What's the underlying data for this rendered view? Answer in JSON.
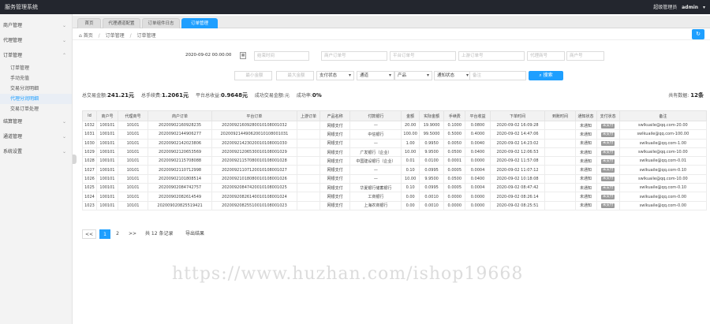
{
  "topbar": {
    "title": "服务管理系统",
    "role": "超级管理员",
    "username": "admin"
  },
  "sidebar": {
    "groups": [
      {
        "label": "商户管理"
      },
      {
        "label": "代理管理"
      },
      {
        "label": "订单管理",
        "children": [
          "订单管理",
          "手动充值",
          "交易分润明细",
          "代理分润明细",
          "交易订单处理"
        ]
      },
      {
        "label": "结算管理"
      },
      {
        "label": "通道管理"
      },
      {
        "label": "系统设置"
      }
    ]
  },
  "tabs": [
    "首页",
    "代理通道配置",
    "订单组件日志",
    "订单管理"
  ],
  "breadcrumb": [
    "首页",
    "订单管理",
    "订单管理"
  ],
  "filters": {
    "date_value": "2020-09-02 00:00:00",
    "date_end_placeholder": "结束时间",
    "merchant_order_placeholder": "商户订单号",
    "platform_order_placeholder": "平台订单号",
    "upstream_order_placeholder": "上游订单号",
    "agent_id_placeholder": "代理商号",
    "merchant_id_placeholder": "商户号",
    "min_amount_placeholder": "最小金额",
    "max_amount_placeholder": "最大金额",
    "pay_status": "支付状态",
    "channel": "通道",
    "product": "产品",
    "notify_status": "通知状态",
    "remark_placeholder": "备注",
    "search_label": "搜索"
  },
  "stats": {
    "total_amount_label": "总交易金额:",
    "total_amount": "241.21元",
    "total_fee_label": "总手续费:",
    "total_fee": "1.2061元",
    "platform_income_label": "平台总收益:",
    "platform_income": "0.9648元",
    "success_label": "成功交易金额:",
    "success_value": "元",
    "rate_label": "成功率:",
    "rate_value": "0%",
    "count_label": "共有数据:",
    "count_value": "12条"
  },
  "table": {
    "headers": [
      "Id",
      "商户号",
      "代理商号",
      "商户订单",
      "平台订单",
      "上游订单",
      "产品名称",
      "付款银行",
      "金额",
      "实际金额",
      "手续费",
      "平台收益",
      "下单时间",
      "到账时间",
      "通知状态",
      "支付状态",
      "备注"
    ],
    "rows": [
      [
        "1032",
        "100101",
        "10101",
        "2020090216092823​5",
        "2020092160928001010800​1032",
        "",
        "网银支付",
        "—",
        "20.00",
        "19.9000",
        "0.1000",
        "0.0800",
        "2020-09-02 16:09:28",
        "",
        "未通知",
        "未支付",
        "swlkuaile@qq.com-20.00"
      ],
      [
        "1031",
        "100101",
        "10101",
        "2020090214490627​7",
        "2020092144​90620010108001031",
        "",
        "网银支付",
        "中信银行",
        "100.00",
        "99.5000",
        "0.5000",
        "0.4000",
        "2020-09-02 14:47:06",
        "",
        "未通知",
        "未支付",
        "swlkuaile@qq.com-100.00"
      ],
      [
        "1030",
        "100101",
        "10101",
        "20200902142023806",
        "2020092142302001010800​1030",
        "",
        "网银支付",
        "—",
        "1.00",
        "0.9950",
        "0.0050",
        "0.0040",
        "2020-09-02 14:23:02",
        "",
        "未通知",
        "未支付",
        "swlkuaile@qq.com-1.00"
      ],
      [
        "1029",
        "100101",
        "10101",
        "20200902120653569",
        "2020092120653001010800​1029",
        "",
        "网银支付",
        "广发银行（企业）",
        "10.00",
        "9.9500",
        "0.0500",
        "0.0400",
        "2020-09-02 12:06:53",
        "",
        "未通知",
        "未支付",
        "swlkuaile@qq.com-10.00"
      ],
      [
        "1028",
        "100101",
        "10101",
        "20200902115708​088",
        "2020092115708001010800​1028",
        "",
        "网银支付",
        "中国建设银行（企业）",
        "0.01",
        "0.0100",
        "0.0001",
        "0.0000",
        "2020-09-02 11:57:08",
        "",
        "未通知",
        "未支付",
        "swlkuaile@qq.com-0.01"
      ],
      [
        "1027",
        "100101",
        "10101",
        "20200902110712​998",
        "2020092110712001010800​1027",
        "",
        "网银支付",
        "—",
        "0.10",
        "0.0995",
        "0.0005",
        "0.0004",
        "2020-09-02 11:07:12",
        "",
        "未通知",
        "未支付",
        "swlkuaile@qq.com-0.10"
      ],
      [
        "1026",
        "100101",
        "10101",
        "20200902101808​514",
        "2020092101808001010800​1026",
        "",
        "网银支付",
        "—",
        "10.00",
        "9.9500",
        "0.0500",
        "0.0400",
        "2020-09-02 10:18:08",
        "",
        "未通知",
        "未支付",
        "swlkuaile@qq.com-10.00"
      ],
      [
        "1025",
        "100101",
        "10101",
        "20200902084742​757",
        "2020092084742001010800​1025",
        "",
        "网银支付",
        "华夏银行储蓄银行",
        "0.10",
        "0.0995",
        "0.0005",
        "0.0004",
        "2020-09-02 08:47:42",
        "",
        "未通知",
        "未支付",
        "swlkuaile@qq.com-0.10"
      ],
      [
        "1024",
        "100101",
        "10101",
        "20200902082614​549",
        "2020092082614001010800​1024",
        "",
        "网银支付",
        "工商银行",
        "0.00",
        "0.0010",
        "0.0000",
        "0.0000",
        "2020-09-02 08:26:14",
        "",
        "未通知",
        "未支付",
        "swlkuaile@qq.com-0.00"
      ],
      [
        "1023",
        "100101",
        "10101",
        "20200902082551​9421",
        "2020092082551001010800​1023",
        "",
        "网银支付",
        "上海农商银行",
        "0.00",
        "0.0010",
        "0.0000",
        "0.0000",
        "2020-09-02 08:25:51",
        "",
        "未通知",
        "未支付",
        "swlkuaile@qq.com-0.00"
      ]
    ]
  },
  "pager": {
    "first": "<<",
    "p1": "1",
    "p2": "2",
    "last": ">>",
    "summary": "共 12 条记录",
    "export": "导出结果"
  },
  "watermark": "https://www.huzhan.com/ishop19668"
}
